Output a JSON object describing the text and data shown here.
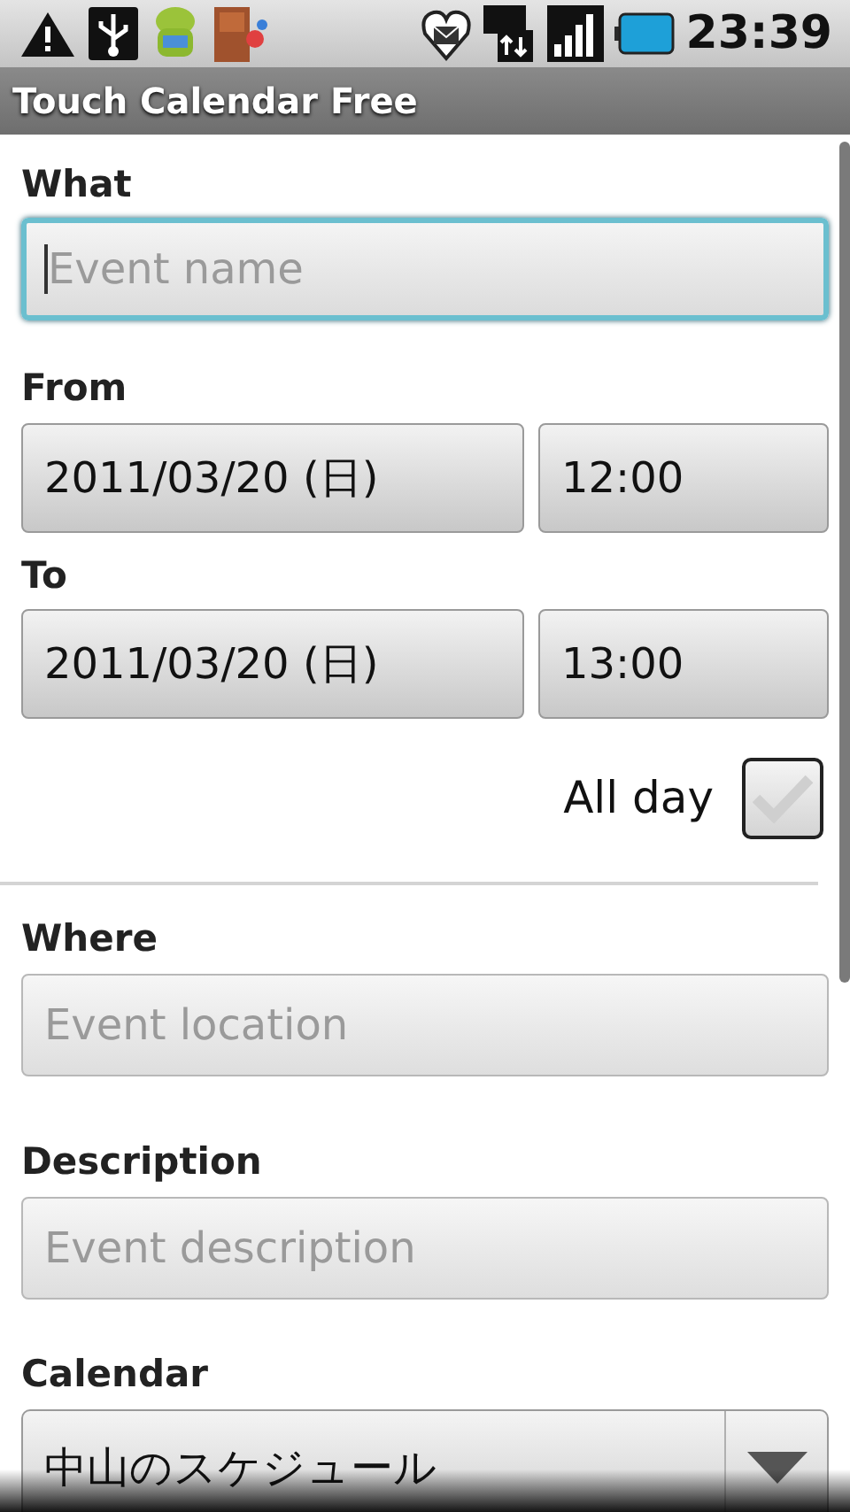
{
  "status_bar": {
    "time": "23:39"
  },
  "window": {
    "title": "Touch Calendar Free"
  },
  "what": {
    "label": "What",
    "placeholder": "Event name",
    "focused": true
  },
  "from": {
    "label": "From",
    "date": "2011/03/20 (日)",
    "time": "12:00"
  },
  "to": {
    "label": "To",
    "date": "2011/03/20 (日)",
    "time": "13:00"
  },
  "all_day": {
    "label": "All day",
    "checked": false
  },
  "where": {
    "label": "Where",
    "placeholder": "Event location"
  },
  "description": {
    "label": "Description",
    "placeholder": "Event description"
  },
  "calendar": {
    "label": "Calendar",
    "value": "中山のスケジュール"
  }
}
